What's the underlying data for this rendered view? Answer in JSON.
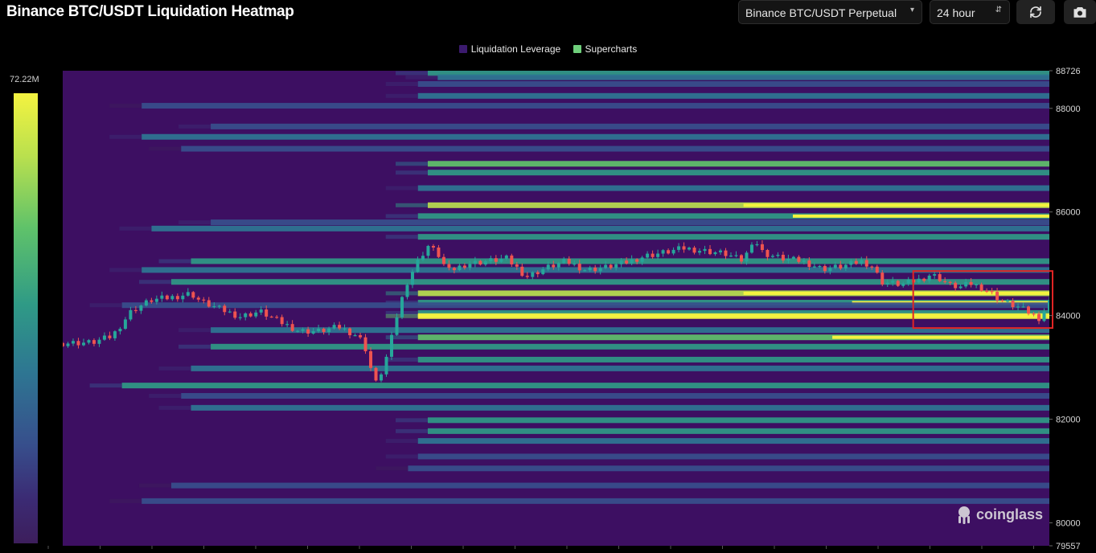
{
  "title": "Binance BTC/USDT Liquidation Heatmap",
  "controls": {
    "market": "Binance BTC/USDT Perpetual",
    "range": "24 hour",
    "refresh_icon": "refresh-icon",
    "camera_icon": "camera-icon"
  },
  "legend": [
    {
      "label": "Liquidation Leverage",
      "color": "#3b1a6e"
    },
    {
      "label": "Supercharts",
      "color": "#6fcf7b"
    }
  ],
  "colorbar": {
    "max_label": "72.22M"
  },
  "watermark": "coinglass",
  "chart_data": {
    "type": "heatmap",
    "title": "Binance BTC/USDT Liquidation Heatmap",
    "ylim": [
      79557,
      88726
    ],
    "y_ticks": [
      {
        "label": "88726",
        "value": 88726
      },
      {
        "label": "88000",
        "value": 88000
      },
      {
        "label": "86000",
        "value": 86000
      },
      {
        "label": "84000",
        "value": 84000
      },
      {
        "label": "82000",
        "value": 82000
      },
      {
        "label": "80000",
        "value": 80000
      },
      {
        "label": "79557",
        "value": 79557
      }
    ],
    "x_tick_count": 20,
    "time_fraction_range": [
      0,
      1
    ],
    "colors": {
      "background": "#3d0f62",
      "scale": [
        "#3d1e5c",
        "#3b2b74",
        "#374f8c",
        "#2e7692",
        "#2f9a86",
        "#5fc26a",
        "#b9e04e",
        "#f4f340"
      ],
      "highlight_box": "#e02424",
      "candle_up": "#26a69a",
      "candle_down": "#ef5350"
    },
    "liquidation_levels": [
      {
        "price": 88680,
        "start": 0.37,
        "intensity": 0.55
      },
      {
        "price": 88600,
        "start": 0.38,
        "intensity": 0.4
      },
      {
        "price": 88470,
        "start": 0.36,
        "intensity": 0.35
      },
      {
        "price": 88240,
        "start": 0.36,
        "intensity": 0.45
      },
      {
        "price": 88050,
        "start": 0.08,
        "intensity": 0.3
      },
      {
        "price": 87650,
        "start": 0.15,
        "intensity": 0.35
      },
      {
        "price": 87450,
        "start": 0.08,
        "intensity": 0.4
      },
      {
        "price": 87220,
        "start": 0.12,
        "intensity": 0.3
      },
      {
        "price": 86930,
        "start": 0.37,
        "intensity": 0.65
      },
      {
        "price": 86760,
        "start": 0.37,
        "intensity": 0.5
      },
      {
        "price": 86460,
        "start": 0.36,
        "intensity": 0.45
      },
      {
        "price": 86130,
        "start": 0.37,
        "intensity": 0.8,
        "hot_start": 0.69
      },
      {
        "price": 85920,
        "start": 0.36,
        "intensity": 0.5,
        "hot_start": 0.74
      },
      {
        "price": 85800,
        "start": 0.15,
        "intensity": 0.35
      },
      {
        "price": 85680,
        "start": 0.09,
        "intensity": 0.45
      },
      {
        "price": 85520,
        "start": 0.36,
        "intensity": 0.6
      },
      {
        "price": 85050,
        "start": 0.13,
        "intensity": 0.55
      },
      {
        "price": 84880,
        "start": 0.08,
        "intensity": 0.45
      },
      {
        "price": 84650,
        "start": 0.11,
        "intensity": 0.5
      },
      {
        "price": 84430,
        "start": 0.36,
        "intensity": 0.85,
        "hot_start": 0.69
      },
      {
        "price": 84250,
        "start": 0.36,
        "intensity": 0.55,
        "hot_start": 0.8
      },
      {
        "price": 84200,
        "start": 0.06,
        "intensity": 0.35
      },
      {
        "price": 84050,
        "start": 0.36,
        "intensity": 0.5
      },
      {
        "price": 83990,
        "start": 0.36,
        "intensity": 0.95,
        "hot_start": 0.36
      },
      {
        "price": 83720,
        "start": 0.15,
        "intensity": 0.45
      },
      {
        "price": 83580,
        "start": 0.36,
        "intensity": 0.7,
        "hot_start": 0.78
      },
      {
        "price": 83400,
        "start": 0.15,
        "intensity": 0.55
      },
      {
        "price": 83150,
        "start": 0.36,
        "intensity": 0.55
      },
      {
        "price": 82980,
        "start": 0.13,
        "intensity": 0.45
      },
      {
        "price": 82650,
        "start": 0.06,
        "intensity": 0.5
      },
      {
        "price": 82450,
        "start": 0.12,
        "intensity": 0.35
      },
      {
        "price": 82220,
        "start": 0.13,
        "intensity": 0.45
      },
      {
        "price": 81980,
        "start": 0.37,
        "intensity": 0.5
      },
      {
        "price": 81770,
        "start": 0.37,
        "intensity": 0.55
      },
      {
        "price": 81580,
        "start": 0.36,
        "intensity": 0.45
      },
      {
        "price": 81280,
        "start": 0.36,
        "intensity": 0.35
      },
      {
        "price": 81050,
        "start": 0.35,
        "intensity": 0.3
      },
      {
        "price": 80720,
        "start": 0.11,
        "intensity": 0.3
      },
      {
        "price": 80420,
        "start": 0.08,
        "intensity": 0.25
      }
    ],
    "price_path": [
      [
        0.0,
        83470
      ],
      [
        0.03,
        83480
      ],
      [
        0.05,
        83600
      ],
      [
        0.07,
        84100
      ],
      [
        0.09,
        84300
      ],
      [
        0.11,
        84350
      ],
      [
        0.13,
        84430
      ],
      [
        0.14,
        84270
      ],
      [
        0.16,
        84120
      ],
      [
        0.18,
        83980
      ],
      [
        0.2,
        84080
      ],
      [
        0.22,
        83880
      ],
      [
        0.24,
        83700
      ],
      [
        0.26,
        83700
      ],
      [
        0.28,
        83780
      ],
      [
        0.3,
        83600
      ],
      [
        0.31,
        83250
      ],
      [
        0.315,
        82650
      ],
      [
        0.32,
        82750
      ],
      [
        0.33,
        83300
      ],
      [
        0.34,
        84100
      ],
      [
        0.35,
        84700
      ],
      [
        0.36,
        85050
      ],
      [
        0.37,
        85350
      ],
      [
        0.38,
        85200
      ],
      [
        0.39,
        84850
      ],
      [
        0.41,
        85000
      ],
      [
        0.43,
        85050
      ],
      [
        0.45,
        85100
      ],
      [
        0.47,
        84750
      ],
      [
        0.49,
        84920
      ],
      [
        0.51,
        85050
      ],
      [
        0.53,
        84880
      ],
      [
        0.55,
        84930
      ],
      [
        0.57,
        85020
      ],
      [
        0.59,
        85150
      ],
      [
        0.61,
        85220
      ],
      [
        0.63,
        85300
      ],
      [
        0.65,
        85250
      ],
      [
        0.67,
        85200
      ],
      [
        0.69,
        85050
      ],
      [
        0.7,
        85500
      ],
      [
        0.71,
        85200
      ],
      [
        0.73,
        85100
      ],
      [
        0.75,
        85050
      ],
      [
        0.77,
        84900
      ],
      [
        0.79,
        84950
      ],
      [
        0.81,
        85050
      ],
      [
        0.82,
        84960
      ],
      [
        0.83,
        84650
      ],
      [
        0.85,
        84600
      ],
      [
        0.87,
        84700
      ],
      [
        0.88,
        84800
      ],
      [
        0.89,
        84700
      ],
      [
        0.9,
        84580
      ],
      [
        0.91,
        84550
      ],
      [
        0.92,
        84620
      ],
      [
        0.93,
        84550
      ],
      [
        0.94,
        84450
      ],
      [
        0.95,
        84300
      ],
      [
        0.96,
        84220
      ],
      [
        0.97,
        84150
      ],
      [
        0.98,
        84050
      ],
      [
        0.99,
        83950
      ],
      [
        1.0,
        84250
      ]
    ],
    "highlight_region": {
      "x0": 0.862,
      "x1": 1.0,
      "y0": 83760,
      "y1": 84860
    }
  }
}
